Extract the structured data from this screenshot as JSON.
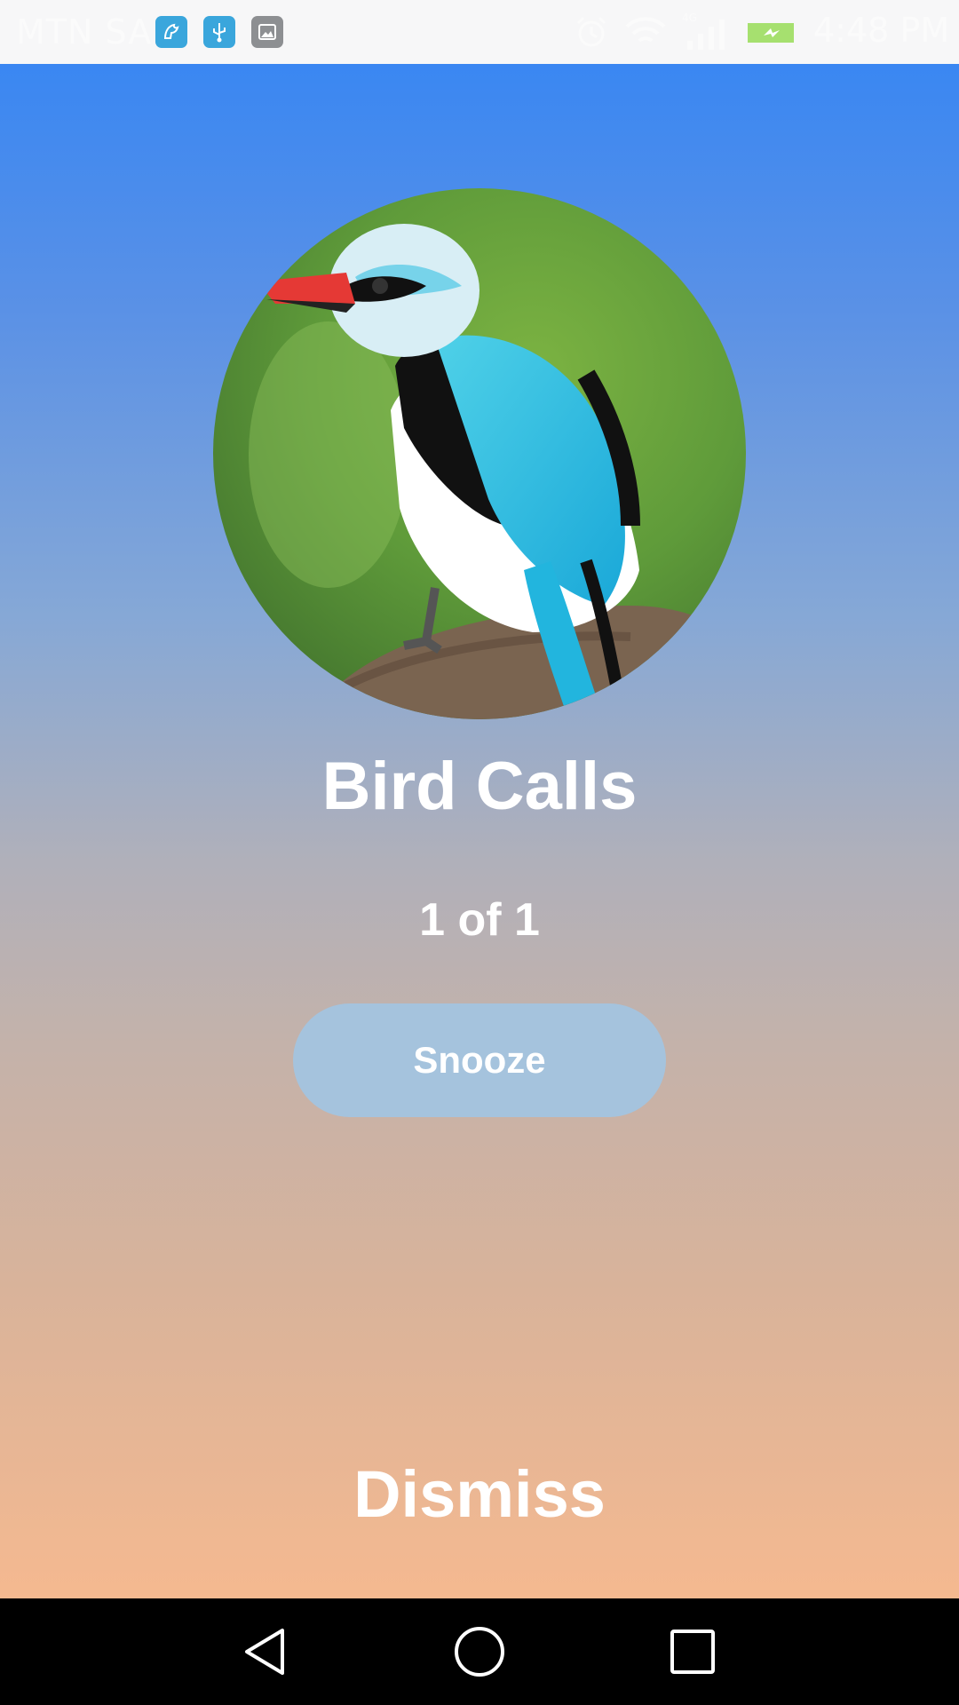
{
  "status_bar": {
    "carrier": "MTN SA",
    "time": "4:48 PM",
    "network_type": "4G",
    "battery_color": "#a6e06f",
    "icons": [
      "app-notification-icon",
      "usb-icon",
      "image-icon",
      "alarm-icon",
      "wifi-icon",
      "signal-icon",
      "battery-charging-icon"
    ]
  },
  "alarm": {
    "title": "Bird Calls",
    "count": "1 of 1",
    "snooze_label": "Snooze",
    "dismiss_label": "Dismiss",
    "image": "bird-photo"
  },
  "nav_bar": {
    "icons": [
      "back-icon",
      "home-icon",
      "recents-icon"
    ]
  },
  "colors": {
    "gradient_top": "#3a87f2",
    "gradient_bottom": "#f5b990",
    "snooze_button": "#a5c3dd",
    "text": "#ffffff"
  }
}
